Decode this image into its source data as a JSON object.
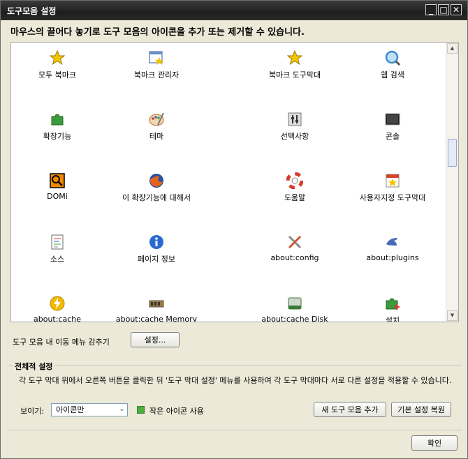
{
  "window": {
    "title": "도구모음 설정",
    "instruction": "마우스의 끌어다 놓기로 도구 모음의 아이콘을 추가 또는 제거할 수 있습니다."
  },
  "palette": {
    "items": [
      {
        "label": "모두 북마크",
        "icon": "star-icon",
        "color": "#f5c400"
      },
      {
        "label": "북마크 관리자",
        "icon": "bookmark-manager-icon",
        "color": "#6b8fc9"
      },
      {
        "label": "북마크 도구막대",
        "icon": "star-icon",
        "color": "#f5c400"
      },
      {
        "label": "웹 검색",
        "icon": "search-icon",
        "color": "#3d8bd0"
      },
      {
        "label": "확장기능",
        "icon": "puzzle-icon",
        "color": "#3c9a3c"
      },
      {
        "label": "테마",
        "icon": "palette-icon",
        "color": "#b56a2a"
      },
      {
        "label": "선택사항",
        "icon": "options-icon",
        "color": "#777777"
      },
      {
        "label": "콘솔",
        "icon": "console-icon",
        "color": "#222222"
      },
      {
        "label": "DOMi",
        "icon": "dom-inspector-icon",
        "color": "#f08a00"
      },
      {
        "label": "이 확장기능에 대해서",
        "icon": "firefox-icon",
        "color": "#e4631c"
      },
      {
        "label": "도움말",
        "icon": "lifebuoy-icon",
        "color": "#d43b2c"
      },
      {
        "label": "사용자지정 도구막대",
        "icon": "customize-icon",
        "color": "#d0462c"
      },
      {
        "label": "소스",
        "icon": "source-icon",
        "color": "#6a6a6a"
      },
      {
        "label": "페이지 정보",
        "icon": "info-icon",
        "color": "#2a6ad0"
      },
      {
        "label": "about:config",
        "icon": "tools-icon",
        "color": "#8a8a8a"
      },
      {
        "label": "about:plugins",
        "icon": "plugins-icon",
        "color": "#4a6ab8"
      },
      {
        "label": "about:cache",
        "icon": "lightning-icon",
        "color": "#f5b800"
      },
      {
        "label": "about:cache Memory",
        "icon": "memory-icon",
        "color": "#9a7a3a"
      },
      {
        "label": "about:cache Disk",
        "icon": "disk-icon",
        "color": "#3a7a3a"
      },
      {
        "label": "설치",
        "icon": "install-icon",
        "color": "#3c9a3c"
      }
    ]
  },
  "row1": {
    "hide_menu_label": "도구 모음 내 이동 메뉴 감추기",
    "settings_button": "설정..."
  },
  "global": {
    "title": "전체적 설정",
    "description": "각 도구 막대 위에서 오른쪽 버튼을 클릭한 뒤 '도구 막대 설정' 메뉴를 사용하여 각 도구 막대마다 서로 다른 설정을 적용할 수 있습니다.",
    "show_label": "보이기:",
    "show_value": "아이콘만",
    "small_icons_label": "작은 아이콘 사용",
    "new_toolbar_button": "새 도구 모음 추가",
    "restore_button": "기본 설정 복원"
  },
  "footer": {
    "ok_button": "확인"
  }
}
